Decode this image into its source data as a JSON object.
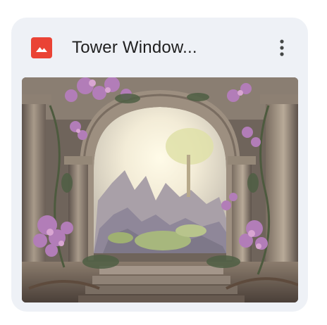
{
  "card": {
    "title": "Tower Window...",
    "file_type_icon": "image-file-icon",
    "menu_icon": "more-vert-icon",
    "thumbnail": {
      "icon": "thumbnail-image",
      "subject": "stone-archway-with-flowers-and-mountain-view"
    }
  },
  "colors": {
    "card_background": "#eef1f6",
    "file_icon_red": "#ea4335",
    "title_text": "#1f1f1f"
  }
}
